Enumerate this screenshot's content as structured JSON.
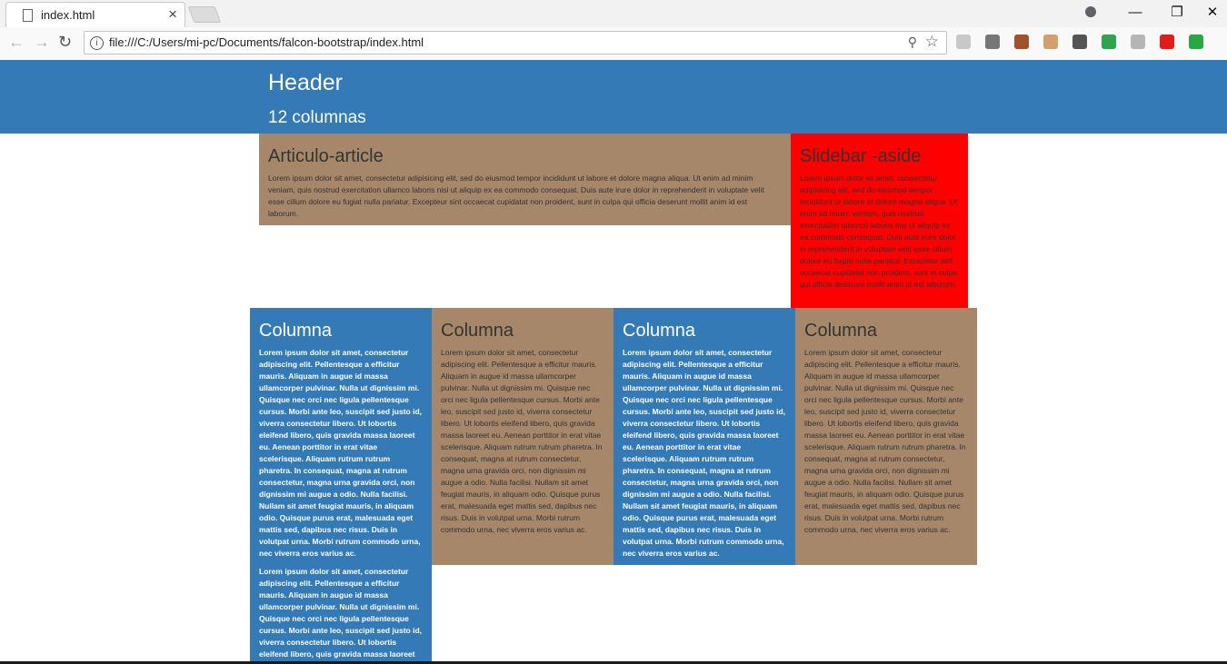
{
  "browser": {
    "tab_title": "index.html",
    "tab_close": "×",
    "url": "file:///C:/Users/mi-pc/Documents/falcon-bootstrap/index.html",
    "info_glyph": "i",
    "min_glyph": "—",
    "restore_glyph": "❐",
    "close_glyph": "✕",
    "back_glyph": "←",
    "forward_glyph": "→",
    "reload_glyph": "↻",
    "star_glyph": "☆",
    "zoom_glyph": "⚲",
    "extensions": [
      {
        "name": "pdf-extension-icon",
        "color": "#c8c8c8"
      },
      {
        "name": "layers-extension-icon",
        "color": "#777777"
      },
      {
        "name": "eyedropper-extension-icon",
        "color": "#a0522d"
      },
      {
        "name": "ruler-extension-icon",
        "color": "#d2a06a"
      },
      {
        "name": "move-extension-icon",
        "color": "#555555"
      },
      {
        "name": "evernote-extension-icon",
        "color": "#2ea44f"
      },
      {
        "name": "k-extension-icon",
        "color": "#b5b5b5"
      },
      {
        "name": "opera-extension-icon",
        "color": "#e21b1b"
      },
      {
        "name": "green-circle-extension-icon",
        "color": "#28a745"
      }
    ]
  },
  "header": {
    "title": "Header",
    "subtitle": "12 columnas"
  },
  "article": {
    "title": "Articulo-article",
    "text": "Lorem ipsum dolor sit amet, consectetur adipisicing elit, sed do eiusmod tempor incididunt ut labore et dolore magna aliqua. Ut enim ad minim veniam, quis nostrud exercitation ullamco laboris nisi ut aliquip ex ea commodo consequat. Duis aute irure dolor in reprehenderit in voluptate velit esse cillum dolore eu fugiat nulla pariatur. Excepteur sint occaecat cupidatat non proident, sunt in culpa qui officia deserunt mollit anim id est laborum."
  },
  "aside": {
    "title": "Slidebar -aside",
    "text": "Lorem ipsum dolor sit amet, consectetur adipisicing elit, sed do eiusmod tempor incididunt ut labore et dolore magna aliqua. Ut enim ad minim veniam, quis nostrud exercitation ullamco laboris nisi ut aliquip ex ea commodo consequat. Duis aute irure dolor in reprehenderit in voluptate velit esse cillum dolore eu fugiat nulla pariatur. Excepteur sint occaecat cupidatat non proident, sunt in culpa qui officia deserunt mollit anim id est laborum."
  },
  "columns": [
    {
      "title": "Columna",
      "text": "Lorem ipsum dolor sit amet, consectetur adipiscing elit. Pellentesque a efficitur mauris. Aliquam in augue id massa ullamcorper pulvinar. Nulla ut dignissim mi. Quisque nec orci nec ligula pellentesque cursus. Morbi ante leo, suscipit sed justo id, viverra consectetur libero. Ut lobortis eleifend libero, quis gravida massa laoreet eu. Aenean porttitor in erat vitae scelerisque. Aliquam rutrum rutrum pharetra. In consequat, magna at rutrum consectetur, magna urna gravida orci, non dignissim mi augue a odio. Nulla facilisi. Nullam sit amet feugiat mauris, in aliquam odio. Quisque purus erat, malesuada eget mattis sed, dapibus nec risus. Duis in volutpat urna. Morbi rutrum commodo urna, nec viverra eros varius ac.",
      "text2": "Lorem ipsum dolor sit amet, consectetur adipiscing elit. Pellentesque a efficitur mauris. Aliquam in augue id massa ullamcorper pulvinar. Nulla ut dignissim mi. Quisque nec orci nec ligula pellentesque cursus. Morbi ante leo, suscipit sed justo id, viverra consectetur libero. Ut lobortis eleifend libero, quis gravida massa laoreet"
    },
    {
      "title": "Columna",
      "text": "Lorem ipsum dolor sit amet, consectetur adipiscing elit. Pellentesque a efficitur mauris. Aliquam in augue id massa ullamcorper pulvinar. Nulla ut dignissim mi. Quisque nec orci nec ligula pellentesque cursus. Morbi ante leo, suscipit sed justo id, viverra consectetur libero. Ut lobortis eleifend libero, quis gravida massa laoreet eu. Aenean porttitor in erat vitae scelerisque. Aliquam rutrum rutrum pharetra. In consequat, magna at rutrum consectetur, magna urna gravida orci, non dignissim mi augue a odio. Nulla facilisi. Nullam sit amet feugiat mauris, in aliquam odio. Quisque purus erat, malesuada eget mattis sed, dapibus nec risus. Duis in volutpat urna. Morbi rutrum commodo urna, nec viverra eros varius ac."
    },
    {
      "title": "Columna",
      "text": "Lorem ipsum dolor sit amet, consectetur adipiscing elit. Pellentesque a efficitur mauris. Aliquam in augue id massa ullamcorper pulvinar. Nulla ut dignissim mi. Quisque nec orci nec ligula pellentesque cursus. Morbi ante leo, suscipit sed justo id, viverra consectetur libero. Ut lobortis eleifend libero, quis gravida massa laoreet eu. Aenean porttitor in erat vitae scelerisque. Aliquam rutrum rutrum pharetra. In consequat, magna at rutrum consectetur, magna urna gravida orci, non dignissim mi augue a odio. Nulla facilisi. Nullam sit amet feugiat mauris, in aliquam odio. Quisque purus erat, malesuada eget mattis sed, dapibus nec risus. Duis in volutpat urna. Morbi rutrum commodo urna, nec viverra eros varius ac."
    },
    {
      "title": "Columna",
      "text": "Lorem ipsum dolor sit amet, consectetur adipiscing elit. Pellentesque a efficitur mauris. Aliquam in augue id massa ullamcorper pulvinar. Nulla ut dignissim mi. Quisque nec orci nec ligula pellentesque cursus. Morbi ante leo, suscipit sed justo id, viverra consectetur libero. Ut lobortis eleifend libero, quis gravida massa laoreet eu. Aenean porttitor in erat vitae scelerisque. Aliquam rutrum rutrum pharetra. In consequat, magna at rutrum consectetur, magna urna gravida orci, non dignissim mi augue a odio. Nulla facilisi. Nullam sit amet feugiat mauris, in aliquam odio. Quisque purus erat, malesuada eget mattis sed, dapibus nec risus. Duis in volutpat urna. Morbi rutrum commodo urna, nec viverra eros varius ac."
    }
  ],
  "colors": {
    "header_blue": "#337ab7",
    "brown": "#a6876a",
    "aside_red": "#ff0000"
  }
}
